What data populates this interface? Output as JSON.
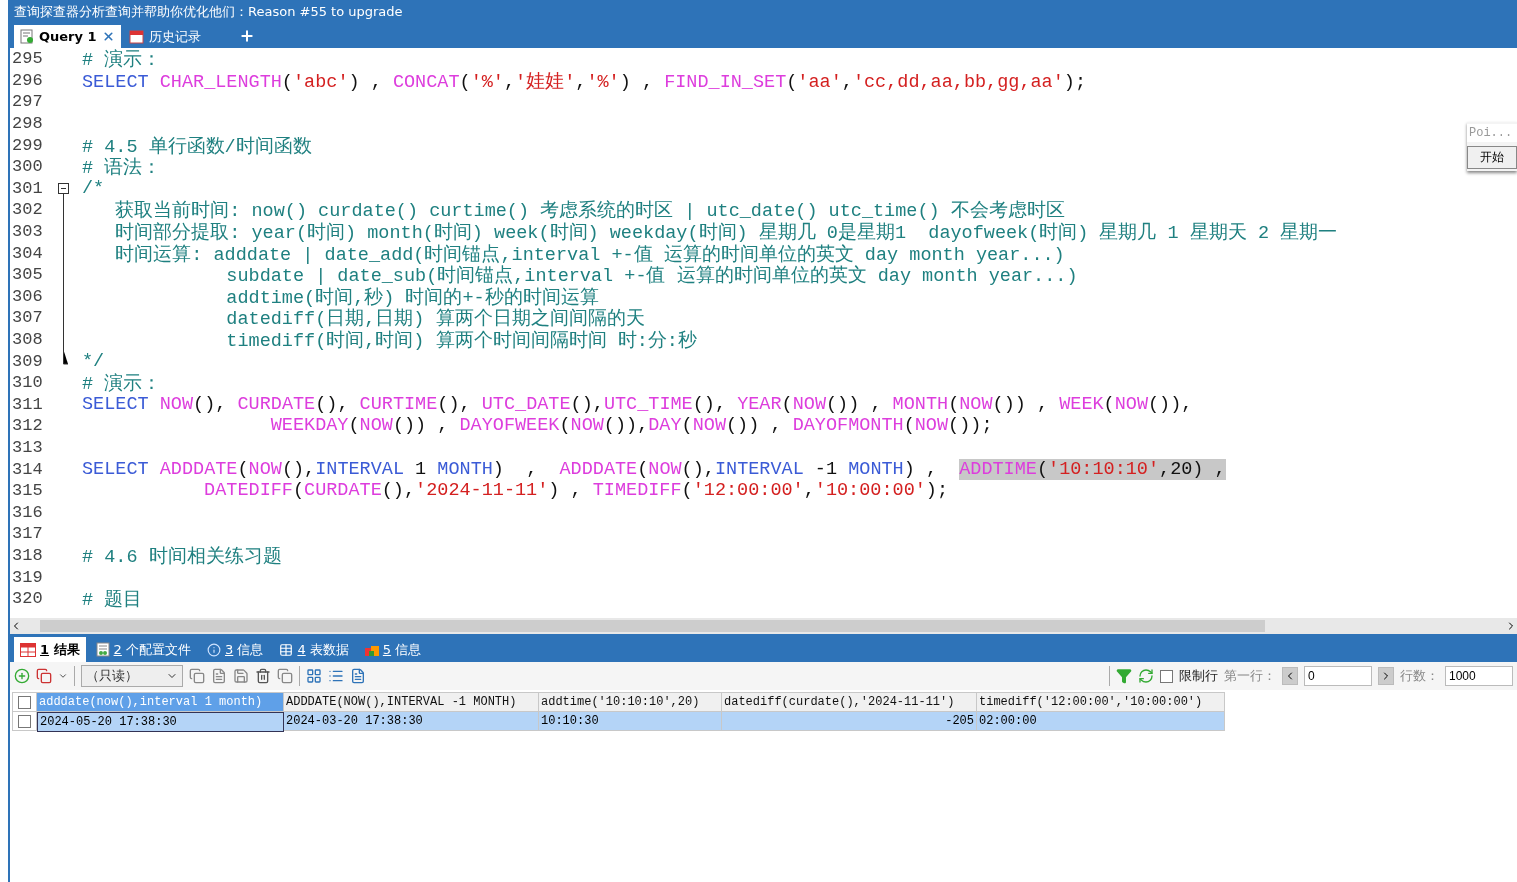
{
  "window": {
    "title": "查询探查器分析查询并帮助你优化他们：Reason #55 to upgrade"
  },
  "tabs": [
    {
      "label": "Query 1",
      "kind": "query",
      "selected": true
    },
    {
      "label": "历史记录",
      "kind": "history",
      "selected": false
    }
  ],
  "editor": {
    "lines": [
      {
        "number": "295",
        "tokens": [
          {
            "kind": "comment",
            "text": "# 演示："
          }
        ]
      },
      {
        "number": "296",
        "tokens": [
          {
            "kind": "keyword",
            "text": "SELECT"
          },
          {
            "kind": "function",
            "text": " CHAR_LENGTH"
          },
          {
            "kind": "plain",
            "text": "("
          },
          {
            "kind": "string",
            "text": "'abc'"
          },
          {
            "kind": "plain",
            "text": ") , "
          },
          {
            "kind": "function",
            "text": "CONCAT"
          },
          {
            "kind": "plain",
            "text": "("
          },
          {
            "kind": "string",
            "text": "'%'"
          },
          {
            "kind": "plain",
            "text": ","
          },
          {
            "kind": "string",
            "text": "'娃娃'"
          },
          {
            "kind": "plain",
            "text": ","
          },
          {
            "kind": "string",
            "text": "'%'"
          },
          {
            "kind": "plain",
            "text": ") , "
          },
          {
            "kind": "function",
            "text": "FIND_IN_SET"
          },
          {
            "kind": "plain",
            "text": "("
          },
          {
            "kind": "string",
            "text": "'aa'"
          },
          {
            "kind": "plain",
            "text": ","
          },
          {
            "kind": "string",
            "text": "'cc,dd,aa,bb,gg,aa'"
          },
          {
            "kind": "plain",
            "text": ");"
          }
        ]
      },
      {
        "number": "297"
      },
      {
        "number": "298"
      },
      {
        "number": "299",
        "tokens": [
          {
            "kind": "comment",
            "text": "# 4.5 单行函数/时间函数"
          }
        ]
      },
      {
        "number": "300",
        "tokens": [
          {
            "kind": "comment",
            "text": "# 语法："
          }
        ]
      },
      {
        "number": "301",
        "expanded": true,
        "tokens": [
          {
            "kind": "comment",
            "text": "/*"
          }
        ],
        "children": [
          {
            "number": "302",
            "tokens": [
              {
                "kind": "comment",
                "text": "   获取当前时间: now() curdate() curtime() 考虑系统的时区 | utc_date() utc_time() 不会考虑时区"
              }
            ]
          },
          {
            "number": "303",
            "tokens": [
              {
                "kind": "comment",
                "text": "   时间部分提取: year(时间) month(时间) week(时间) weekday(时间) 星期几 0是星期1  dayofweek(时间) 星期几 1 星期天 2 星期一"
              }
            ]
          },
          {
            "number": "304",
            "tokens": [
              {
                "kind": "comment",
                "text": "   时间运算: adddate | date_add(时间锚点,interval +-值 运算的时间单位的英文 day month year...)"
              }
            ]
          },
          {
            "number": "305",
            "tokens": [
              {
                "kind": "comment",
                "text": "             subdate | date_sub(时间锚点,interval +-值 运算的时间单位的英文 day month year...)"
              }
            ]
          },
          {
            "number": "306",
            "tokens": [
              {
                "kind": "comment",
                "text": "             addtime(时间,秒) 时间的+-秒的时间运算"
              }
            ]
          },
          {
            "number": "307",
            "tokens": [
              {
                "kind": "comment",
                "text": "             datediff(日期,日期) 算两个日期之间间隔的天"
              }
            ]
          },
          {
            "number": "308",
            "tokens": [
              {
                "kind": "comment",
                "text": "             timediff(时间,时间) 算两个时间间隔时间 时:分:秒"
              }
            ]
          },
          {
            "number": "309",
            "tokens": [
              {
                "kind": "comment",
                "text": "*/"
              }
            ]
          }
        ]
      },
      {
        "number": "310",
        "tokens": [
          {
            "kind": "comment",
            "text": "# 演示："
          }
        ]
      },
      {
        "number": "311",
        "tokens": [
          {
            "kind": "keyword",
            "text": "SELECT"
          },
          {
            "kind": "function",
            "text": " NOW"
          },
          {
            "kind": "plain",
            "text": "(), "
          },
          {
            "kind": "function",
            "text": "CURDATE"
          },
          {
            "kind": "plain",
            "text": "(), "
          },
          {
            "kind": "function",
            "text": "CURTIME"
          },
          {
            "kind": "plain",
            "text": "(), "
          },
          {
            "kind": "function",
            "text": "UTC_DATE"
          },
          {
            "kind": "plain",
            "text": "(),"
          },
          {
            "kind": "function",
            "text": "UTC_TIME"
          },
          {
            "kind": "plain",
            "text": "(), "
          },
          {
            "kind": "function",
            "text": "YEAR"
          },
          {
            "kind": "plain",
            "text": "("
          },
          {
            "kind": "function",
            "text": "NOW"
          },
          {
            "kind": "plain",
            "text": "()) , "
          },
          {
            "kind": "function",
            "text": "MONTH"
          },
          {
            "kind": "plain",
            "text": "("
          },
          {
            "kind": "function",
            "text": "NOW"
          },
          {
            "kind": "plain",
            "text": "()) , "
          },
          {
            "kind": "function",
            "text": "WEEK"
          },
          {
            "kind": "plain",
            "text": "("
          },
          {
            "kind": "function",
            "text": "NOW"
          },
          {
            "kind": "plain",
            "text": "()),"
          }
        ]
      },
      {
        "number": "312",
        "tokens": [
          {
            "kind": "function",
            "text": "                 WEEKDAY"
          },
          {
            "kind": "plain",
            "text": "("
          },
          {
            "kind": "function",
            "text": "NOW"
          },
          {
            "kind": "plain",
            "text": "()) , "
          },
          {
            "kind": "function",
            "text": "DAYOFWEEK"
          },
          {
            "kind": "plain",
            "text": "("
          },
          {
            "kind": "function",
            "text": "NOW"
          },
          {
            "kind": "plain",
            "text": "()),"
          },
          {
            "kind": "function",
            "text": "DAY"
          },
          {
            "kind": "plain",
            "text": "("
          },
          {
            "kind": "function",
            "text": "NOW"
          },
          {
            "kind": "plain",
            "text": "()) , "
          },
          {
            "kind": "function",
            "text": "DAYOFMONTH"
          },
          {
            "kind": "plain",
            "text": "("
          },
          {
            "kind": "function",
            "text": "NOW"
          },
          {
            "kind": "plain",
            "text": "());"
          }
        ]
      },
      {
        "number": "313"
      },
      {
        "number": "314",
        "tokens": [
          {
            "kind": "keyword",
            "text": "SELECT",
            "selected": false
          },
          {
            "kind": "function",
            "text": " ADDDATE",
            "selected": false
          },
          {
            "kind": "plain",
            "text": "(",
            "selected": false
          },
          {
            "kind": "function",
            "text": "NOW",
            "selected": false
          },
          {
            "kind": "plain",
            "text": "(),",
            "selected": false
          },
          {
            "kind": "keyword",
            "text": "INTERVAL",
            "selected": false
          },
          {
            "kind": "plain",
            "text": " 1 ",
            "selected": false
          },
          {
            "kind": "keyword",
            "text": "MONTH",
            "selected": false
          },
          {
            "kind": "plain",
            "text": ")  ,  ",
            "selected": false
          },
          {
            "kind": "function",
            "text": "ADDDATE",
            "selected": false
          },
          {
            "kind": "plain",
            "text": "(",
            "selected": false
          },
          {
            "kind": "function",
            "text": "NOW",
            "selected": false
          },
          {
            "kind": "plain",
            "text": "(),",
            "selected": false
          },
          {
            "kind": "keyword",
            "text": "INTERVAL",
            "selected": false
          },
          {
            "kind": "plain",
            "text": " -1 ",
            "selected": false
          },
          {
            "kind": "keyword",
            "text": "MONTH",
            "selected": false
          },
          {
            "kind": "plain",
            "text": ") ,  ",
            "selected": false
          },
          {
            "kind": "function",
            "text": "ADDTIME",
            "selected": true
          },
          {
            "kind": "plain",
            "text": "(",
            "selected": true
          },
          {
            "kind": "string",
            "text": "'10:10:10'",
            "selected": true
          },
          {
            "kind": "plain",
            "text": ",20) ,",
            "selected": true
          }
        ]
      },
      {
        "number": "315",
        "tokens": [
          {
            "kind": "function",
            "text": "           DATEDIFF"
          },
          {
            "kind": "plain",
            "text": "("
          },
          {
            "kind": "function",
            "text": "CURDATE"
          },
          {
            "kind": "plain",
            "text": "(),"
          },
          {
            "kind": "string",
            "text": "'2024-11-11'"
          },
          {
            "kind": "plain",
            "text": ") , "
          },
          {
            "kind": "function",
            "text": "TIMEDIFF"
          },
          {
            "kind": "plain",
            "text": "("
          },
          {
            "kind": "string",
            "text": "'12:00:00'"
          },
          {
            "kind": "plain",
            "text": ","
          },
          {
            "kind": "string",
            "text": "'10:00:00'"
          },
          {
            "kind": "plain",
            "text": ");"
          }
        ]
      },
      {
        "number": "316"
      },
      {
        "number": "317"
      },
      {
        "number": "318",
        "tokens": [
          {
            "kind": "comment",
            "text": "# 4.6 时间相关练习题"
          }
        ]
      },
      {
        "number": "319"
      },
      {
        "number": "320",
        "tokens": [
          {
            "kind": "comment",
            "text": "# 题目"
          }
        ]
      }
    ]
  },
  "float_panel": {
    "field": "Poi...",
    "button": "开始"
  },
  "result_tabs": [
    {
      "key": "1",
      "label": "结果",
      "kind": "result",
      "selected": true
    },
    {
      "key": "2",
      "label": "个配置文件",
      "kind": "profile",
      "selected": false
    },
    {
      "key": "3",
      "label": "信息",
      "kind": "info",
      "selected": false
    },
    {
      "key": "4",
      "label": "表数据",
      "kind": "table",
      "selected": false
    },
    {
      "key": "5",
      "label": "信息",
      "kind": "message",
      "selected": false
    }
  ],
  "toolbar": {
    "mode": "（只读）",
    "limit_rows": {
      "label": "限制行",
      "checked": false
    },
    "first_row_label": "第一行：",
    "first_row": "0",
    "rows_label": "行数：",
    "rows": "1000"
  },
  "grid": {
    "all_checked": false,
    "columns": [
      {
        "label": "adddate(now(),interval 1 month)",
        "kind": "text",
        "selected": true
      },
      {
        "label": "ADDDATE(NOW(),INTERVAL -1 MONTH)",
        "kind": "text",
        "selected": false
      },
      {
        "label": "addtime('10:10:10',20)",
        "kind": "text",
        "selected": false
      },
      {
        "label": "datediff(curdate(),'2024-11-11')",
        "kind": "number",
        "selected": false
      },
      {
        "label": "timediff('12:00:00','10:00:00')",
        "kind": "text",
        "selected": false
      }
    ],
    "rows": [
      {
        "selected": true,
        "checked": false,
        "cells": [
          {
            "text": "2024-05-20 17:38:30",
            "focused": true
          },
          {
            "text": "2024-03-20 17:38:30",
            "focused": false
          },
          {
            "text": "10:10:30",
            "focused": false
          },
          {
            "text": "-205",
            "focused": false
          },
          {
            "text": "02:00:00",
            "focused": false
          }
        ]
      }
    ]
  }
}
